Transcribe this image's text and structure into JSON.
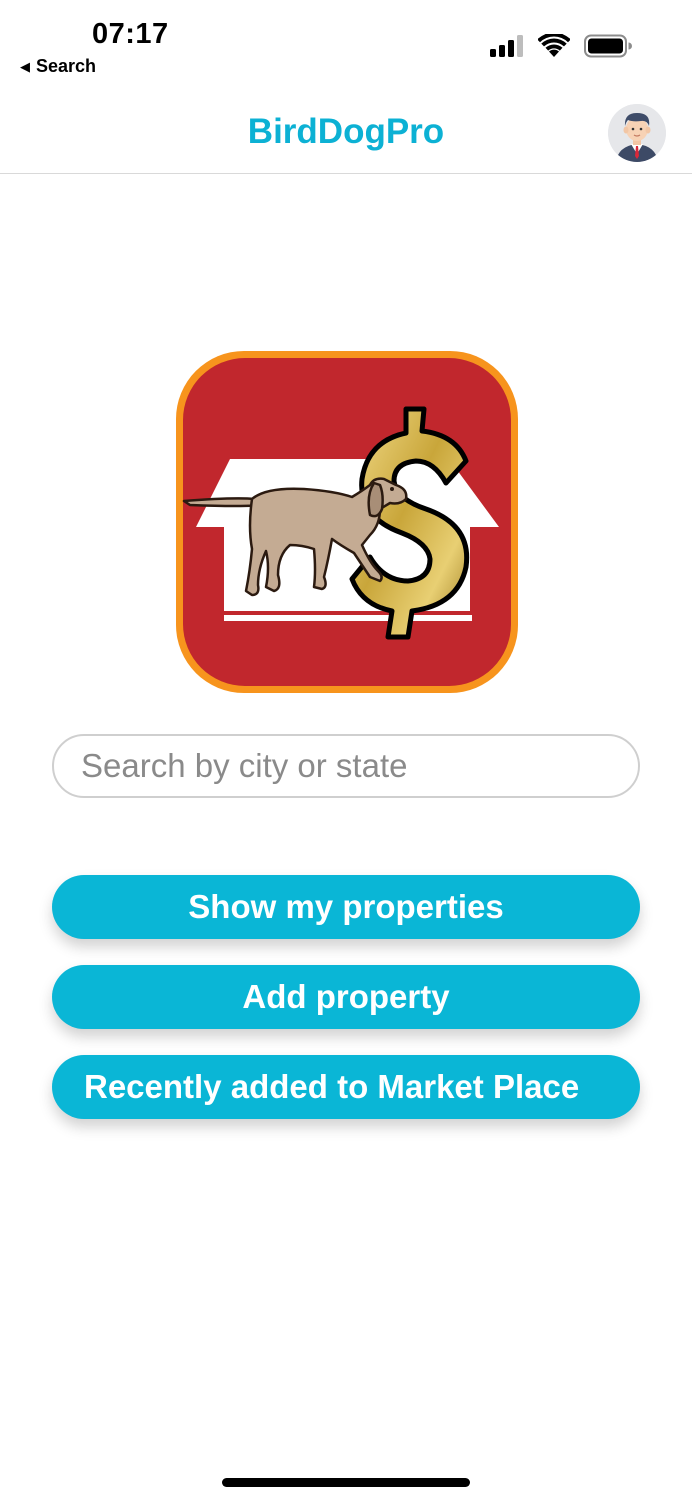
{
  "status_bar": {
    "time": "07:17",
    "back_label": "Search",
    "icons": [
      "signal-icon",
      "wifi-icon",
      "battery-icon"
    ]
  },
  "nav": {
    "title": "BirdDogPro",
    "avatar_icon": "user-avatar-icon"
  },
  "logo": {
    "name": "birddogpro-logo",
    "colors": {
      "background": "#c1272d",
      "border": "#f7941d",
      "house": "#ffffff",
      "dollar": "#c9a63a"
    }
  },
  "search": {
    "placeholder": "Search by city or state",
    "value": ""
  },
  "buttons": {
    "show_properties": "Show my properties",
    "add_property": "Add property",
    "recently_added": "Recently added to Market Place"
  },
  "colors": {
    "accent": "#0ab6d6",
    "title": "#0cb1d4"
  }
}
